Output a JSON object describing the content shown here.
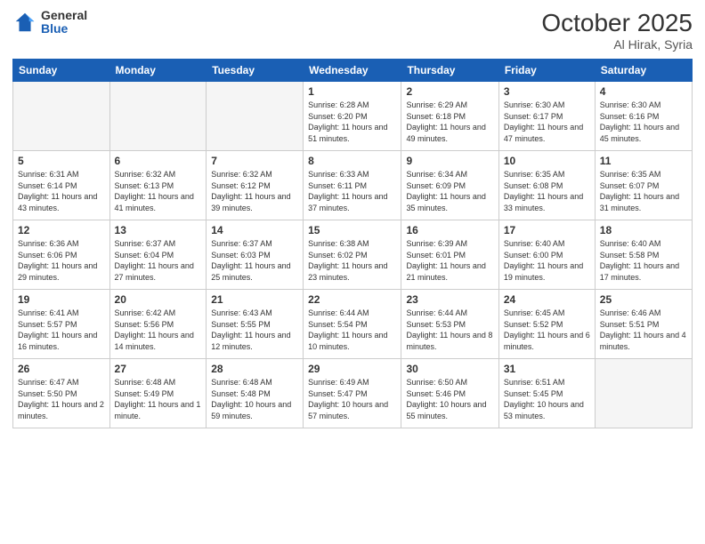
{
  "header": {
    "logo": {
      "general": "General",
      "blue": "Blue"
    },
    "title": "October 2025",
    "location": "Al Hirak, Syria"
  },
  "days_of_week": [
    "Sunday",
    "Monday",
    "Tuesday",
    "Wednesday",
    "Thursday",
    "Friday",
    "Saturday"
  ],
  "weeks": [
    [
      {
        "day": "",
        "sunrise": "",
        "sunset": "",
        "daylight": "",
        "empty": true
      },
      {
        "day": "",
        "sunrise": "",
        "sunset": "",
        "daylight": "",
        "empty": true
      },
      {
        "day": "",
        "sunrise": "",
        "sunset": "",
        "daylight": "",
        "empty": true
      },
      {
        "day": "1",
        "sunrise": "Sunrise: 6:28 AM",
        "sunset": "Sunset: 6:20 PM",
        "daylight": "Daylight: 11 hours and 51 minutes."
      },
      {
        "day": "2",
        "sunrise": "Sunrise: 6:29 AM",
        "sunset": "Sunset: 6:18 PM",
        "daylight": "Daylight: 11 hours and 49 minutes."
      },
      {
        "day": "3",
        "sunrise": "Sunrise: 6:30 AM",
        "sunset": "Sunset: 6:17 PM",
        "daylight": "Daylight: 11 hours and 47 minutes."
      },
      {
        "day": "4",
        "sunrise": "Sunrise: 6:30 AM",
        "sunset": "Sunset: 6:16 PM",
        "daylight": "Daylight: 11 hours and 45 minutes."
      }
    ],
    [
      {
        "day": "5",
        "sunrise": "Sunrise: 6:31 AM",
        "sunset": "Sunset: 6:14 PM",
        "daylight": "Daylight: 11 hours and 43 minutes."
      },
      {
        "day": "6",
        "sunrise": "Sunrise: 6:32 AM",
        "sunset": "Sunset: 6:13 PM",
        "daylight": "Daylight: 11 hours and 41 minutes."
      },
      {
        "day": "7",
        "sunrise": "Sunrise: 6:32 AM",
        "sunset": "Sunset: 6:12 PM",
        "daylight": "Daylight: 11 hours and 39 minutes."
      },
      {
        "day": "8",
        "sunrise": "Sunrise: 6:33 AM",
        "sunset": "Sunset: 6:11 PM",
        "daylight": "Daylight: 11 hours and 37 minutes."
      },
      {
        "day": "9",
        "sunrise": "Sunrise: 6:34 AM",
        "sunset": "Sunset: 6:09 PM",
        "daylight": "Daylight: 11 hours and 35 minutes."
      },
      {
        "day": "10",
        "sunrise": "Sunrise: 6:35 AM",
        "sunset": "Sunset: 6:08 PM",
        "daylight": "Daylight: 11 hours and 33 minutes."
      },
      {
        "day": "11",
        "sunrise": "Sunrise: 6:35 AM",
        "sunset": "Sunset: 6:07 PM",
        "daylight": "Daylight: 11 hours and 31 minutes."
      }
    ],
    [
      {
        "day": "12",
        "sunrise": "Sunrise: 6:36 AM",
        "sunset": "Sunset: 6:06 PM",
        "daylight": "Daylight: 11 hours and 29 minutes."
      },
      {
        "day": "13",
        "sunrise": "Sunrise: 6:37 AM",
        "sunset": "Sunset: 6:04 PM",
        "daylight": "Daylight: 11 hours and 27 minutes."
      },
      {
        "day": "14",
        "sunrise": "Sunrise: 6:37 AM",
        "sunset": "Sunset: 6:03 PM",
        "daylight": "Daylight: 11 hours and 25 minutes."
      },
      {
        "day": "15",
        "sunrise": "Sunrise: 6:38 AM",
        "sunset": "Sunset: 6:02 PM",
        "daylight": "Daylight: 11 hours and 23 minutes."
      },
      {
        "day": "16",
        "sunrise": "Sunrise: 6:39 AM",
        "sunset": "Sunset: 6:01 PM",
        "daylight": "Daylight: 11 hours and 21 minutes."
      },
      {
        "day": "17",
        "sunrise": "Sunrise: 6:40 AM",
        "sunset": "Sunset: 6:00 PM",
        "daylight": "Daylight: 11 hours and 19 minutes."
      },
      {
        "day": "18",
        "sunrise": "Sunrise: 6:40 AM",
        "sunset": "Sunset: 5:58 PM",
        "daylight": "Daylight: 11 hours and 17 minutes."
      }
    ],
    [
      {
        "day": "19",
        "sunrise": "Sunrise: 6:41 AM",
        "sunset": "Sunset: 5:57 PM",
        "daylight": "Daylight: 11 hours and 16 minutes."
      },
      {
        "day": "20",
        "sunrise": "Sunrise: 6:42 AM",
        "sunset": "Sunset: 5:56 PM",
        "daylight": "Daylight: 11 hours and 14 minutes."
      },
      {
        "day": "21",
        "sunrise": "Sunrise: 6:43 AM",
        "sunset": "Sunset: 5:55 PM",
        "daylight": "Daylight: 11 hours and 12 minutes."
      },
      {
        "day": "22",
        "sunrise": "Sunrise: 6:44 AM",
        "sunset": "Sunset: 5:54 PM",
        "daylight": "Daylight: 11 hours and 10 minutes."
      },
      {
        "day": "23",
        "sunrise": "Sunrise: 6:44 AM",
        "sunset": "Sunset: 5:53 PM",
        "daylight": "Daylight: 11 hours and 8 minutes."
      },
      {
        "day": "24",
        "sunrise": "Sunrise: 6:45 AM",
        "sunset": "Sunset: 5:52 PM",
        "daylight": "Daylight: 11 hours and 6 minutes."
      },
      {
        "day": "25",
        "sunrise": "Sunrise: 6:46 AM",
        "sunset": "Sunset: 5:51 PM",
        "daylight": "Daylight: 11 hours and 4 minutes."
      }
    ],
    [
      {
        "day": "26",
        "sunrise": "Sunrise: 6:47 AM",
        "sunset": "Sunset: 5:50 PM",
        "daylight": "Daylight: 11 hours and 2 minutes."
      },
      {
        "day": "27",
        "sunrise": "Sunrise: 6:48 AM",
        "sunset": "Sunset: 5:49 PM",
        "daylight": "Daylight: 11 hours and 1 minute."
      },
      {
        "day": "28",
        "sunrise": "Sunrise: 6:48 AM",
        "sunset": "Sunset: 5:48 PM",
        "daylight": "Daylight: 10 hours and 59 minutes."
      },
      {
        "day": "29",
        "sunrise": "Sunrise: 6:49 AM",
        "sunset": "Sunset: 5:47 PM",
        "daylight": "Daylight: 10 hours and 57 minutes."
      },
      {
        "day": "30",
        "sunrise": "Sunrise: 6:50 AM",
        "sunset": "Sunset: 5:46 PM",
        "daylight": "Daylight: 10 hours and 55 minutes."
      },
      {
        "day": "31",
        "sunrise": "Sunrise: 6:51 AM",
        "sunset": "Sunset: 5:45 PM",
        "daylight": "Daylight: 10 hours and 53 minutes."
      },
      {
        "day": "",
        "sunrise": "",
        "sunset": "",
        "daylight": "",
        "empty": true
      }
    ]
  ]
}
